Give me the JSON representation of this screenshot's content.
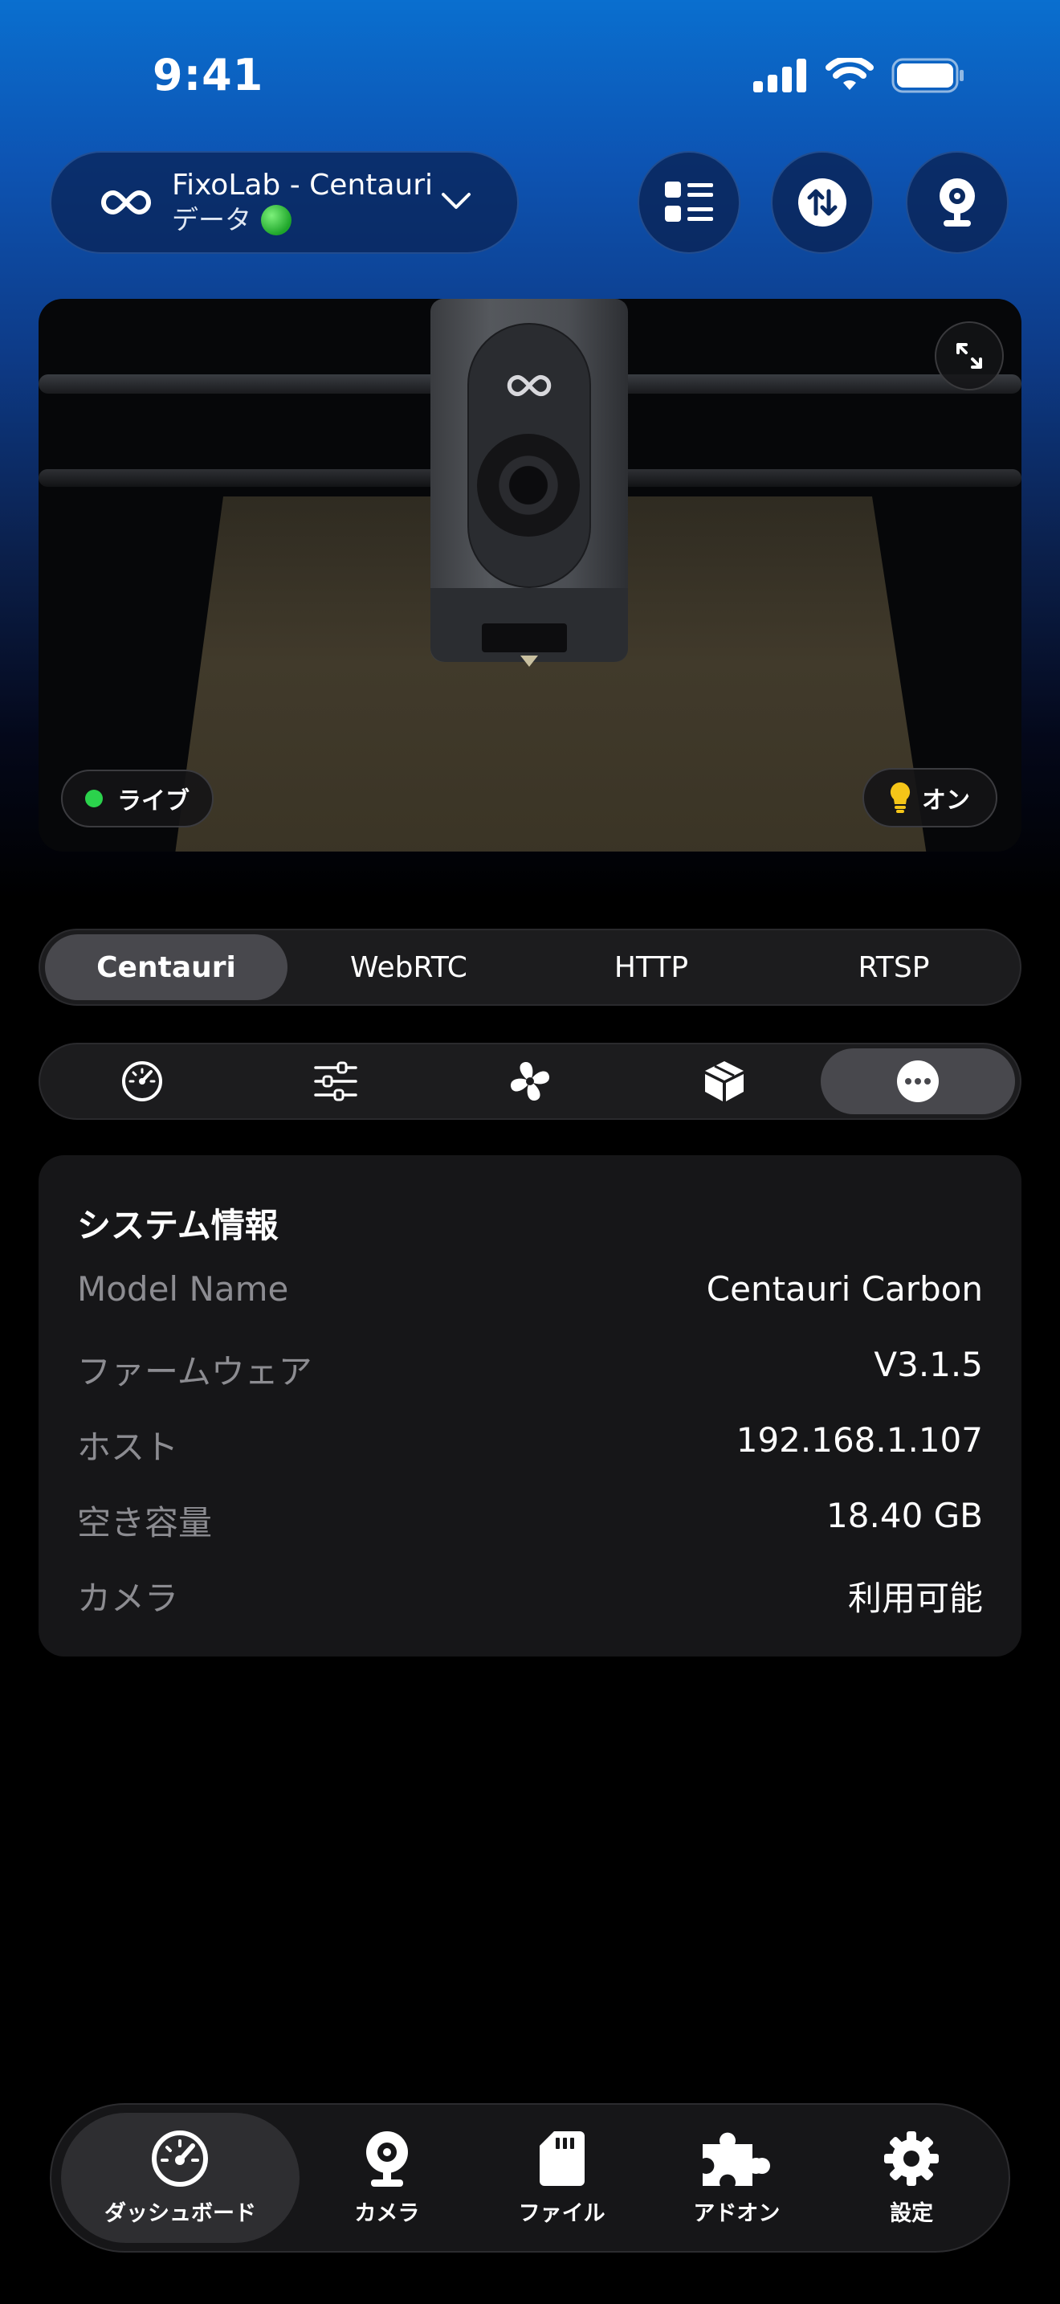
{
  "status_bar": {
    "time": "9:41"
  },
  "header": {
    "printer_name": "FixoLab - Centauri",
    "printer_sub": "データ"
  },
  "camera": {
    "live_label": "ライブ",
    "light_label": "オン"
  },
  "stream_tabs": [
    {
      "label": "Centauri",
      "active": true
    },
    {
      "label": "WebRTC",
      "active": false
    },
    {
      "label": "HTTP",
      "active": false
    },
    {
      "label": "RTSP",
      "active": false
    }
  ],
  "icon_tabs": [
    {
      "icon": "speedometer-icon",
      "active": false
    },
    {
      "icon": "sliders-icon",
      "active": false
    },
    {
      "icon": "fan-icon",
      "active": false
    },
    {
      "icon": "cube-icon",
      "active": false
    },
    {
      "icon": "more-icon",
      "active": true
    }
  ],
  "system_info": {
    "title": "システム情報",
    "rows": [
      {
        "key": "Model Name",
        "value": "Centauri Carbon"
      },
      {
        "key": "ファームウェア",
        "value": "V3.1.5"
      },
      {
        "key": "ホスト",
        "value": "192.168.1.107"
      },
      {
        "key": "空き容量",
        "value": "18.40 GB"
      },
      {
        "key": "カメラ",
        "value": "利用可能"
      }
    ]
  },
  "tab_bar": [
    {
      "label": "ダッシュボード",
      "icon": "gauge-icon",
      "active": true
    },
    {
      "label": "カメラ",
      "icon": "webcam-icon",
      "active": false
    },
    {
      "label": "ファイル",
      "icon": "sd-card-icon",
      "active": false
    },
    {
      "label": "アドオン",
      "icon": "puzzle-icon",
      "active": false
    },
    {
      "label": "設定",
      "icon": "gear-icon",
      "active": false
    }
  ],
  "colors": {
    "accent_green": "#2bd24c",
    "bulb_yellow": "#f5c518",
    "header_blue": "#0a6fcf"
  }
}
